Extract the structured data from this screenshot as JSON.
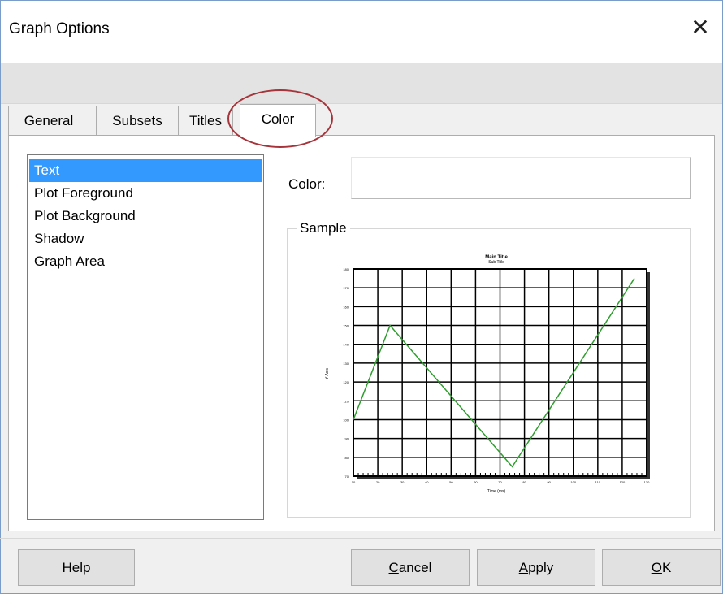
{
  "dialog": {
    "title": "Graph Options",
    "close_glyph": "✕"
  },
  "tabs": [
    {
      "label": "General",
      "active": false
    },
    {
      "label": "Subsets",
      "active": false
    },
    {
      "label": "Titles",
      "active": false
    },
    {
      "label": "Color",
      "active": true
    }
  ],
  "list": {
    "items": [
      "Text",
      "Plot Foreground",
      "Plot Background",
      "Shadow",
      "Graph Area"
    ],
    "selected_index": 0
  },
  "color_field": {
    "label": "Color:",
    "value": ""
  },
  "sample": {
    "legend": "Sample"
  },
  "buttons": {
    "help": "Help",
    "cancel": {
      "mnemonic": "C",
      "rest": "ancel"
    },
    "apply": {
      "mnemonic": "A",
      "rest": "pply"
    },
    "ok": {
      "mnemonic": "O",
      "rest": "K"
    }
  },
  "colors": {
    "selection": "#3399ff",
    "line": "#2e9e2e",
    "annotation": "#a6343a"
  },
  "chart_data": {
    "type": "line",
    "title": "Main Title",
    "subtitle": "Sub Title",
    "xlabel": "Time (ms)",
    "ylabel": "Y Axis",
    "xlim": [
      0,
      12
    ],
    "ylim": [
      70,
      180
    ],
    "x_ticks": [
      "10",
      "20",
      "30",
      "40",
      "50",
      "60",
      "70",
      "80",
      "90",
      "100",
      "110",
      "120",
      "130"
    ],
    "y_ticks": [
      "70",
      "80",
      "90",
      "100",
      "110",
      "120",
      "130",
      "140",
      "150",
      "160",
      "170",
      "180"
    ],
    "grid": true,
    "series": [
      {
        "x": [
          0,
          1.5,
          6.5,
          11.5
        ],
        "y": [
          100,
          150,
          75,
          175
        ]
      }
    ]
  }
}
